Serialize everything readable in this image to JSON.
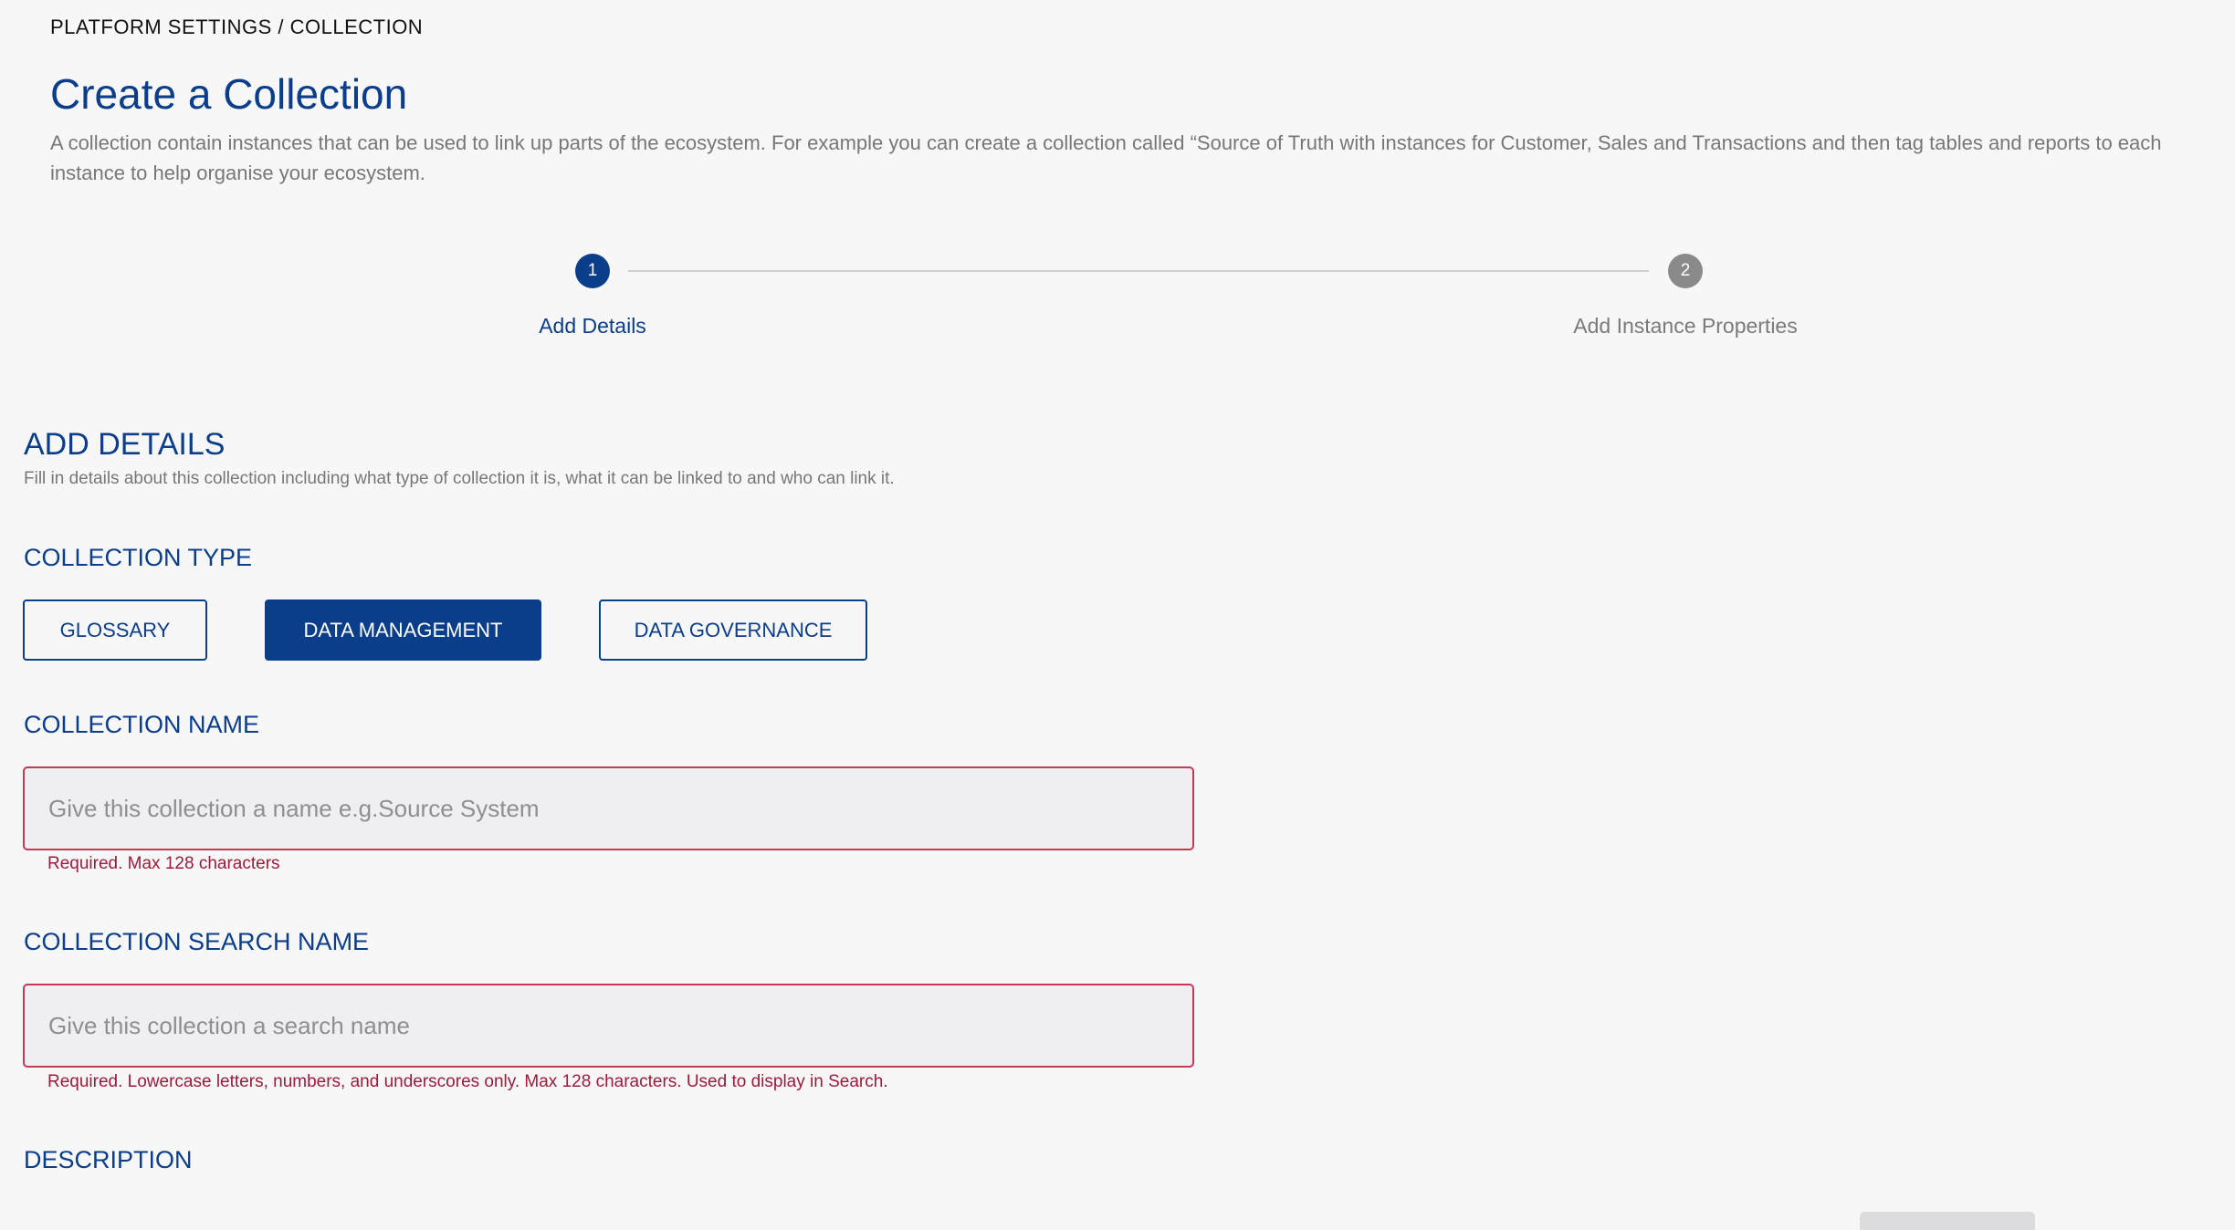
{
  "breadcrumb": "PLATFORM SETTINGS / COLLECTION",
  "page": {
    "title": "Create a Collection",
    "description": "A collection contain instances that can be used to link up parts of the ecosystem. For example you can create a collection called “Source of Truth with instances for Customer, Sales and Transactions and then tag tables and reports to each instance to help organise your ecosystem."
  },
  "stepper": {
    "steps": [
      {
        "number": "1",
        "label": "Add Details",
        "state": "active"
      },
      {
        "number": "2",
        "label": "Add Instance Properties",
        "state": "inactive"
      }
    ]
  },
  "section": {
    "heading": "ADD DETAILS",
    "description": "Fill in details about this collection including what type of collection it is, what it can be linked to and who can link it."
  },
  "collection_type": {
    "label": "COLLECTION TYPE",
    "options": [
      "GLOSSARY",
      "DATA MANAGEMENT",
      "DATA GOVERNANCE"
    ],
    "selected": "DATA MANAGEMENT"
  },
  "collection_name": {
    "label": "COLLECTION NAME",
    "placeholder": "Give this collection a name e.g.Source System",
    "value": "",
    "error": "Required. Max 128 characters"
  },
  "collection_search_name": {
    "label": "COLLECTION SEARCH NAME",
    "placeholder": "Give this collection a search name",
    "value": "",
    "error": "Required. Lowercase letters, numbers, and underscores only. Max 128 characters. Used to display in Search."
  },
  "description_field": {
    "label": "DESCRIPTION"
  },
  "colors": {
    "primary": "#0a3d8a",
    "error": "#9e1a3a",
    "error_border": "#c23b55",
    "inactive_step": "#8a8a8a",
    "background": "#f7f7f8"
  }
}
